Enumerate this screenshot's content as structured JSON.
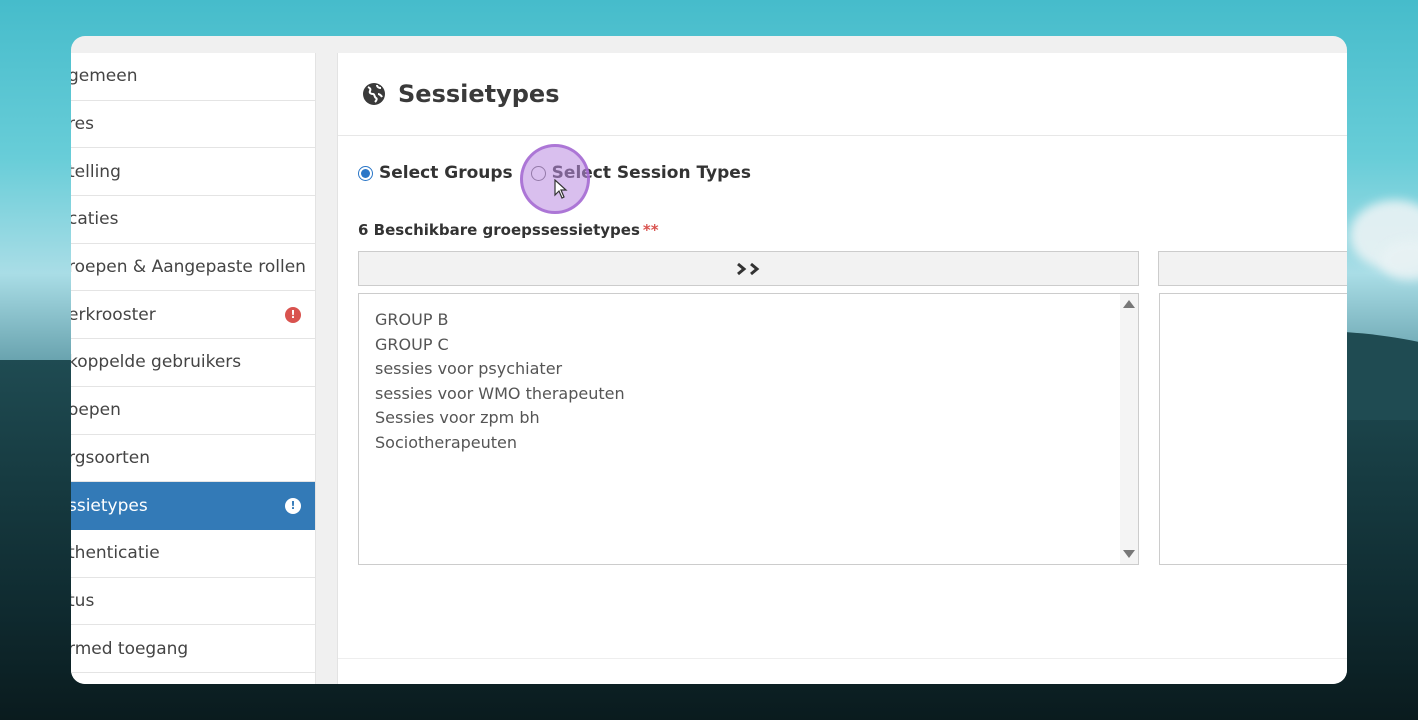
{
  "sidebar": {
    "items": [
      {
        "label": "gemeen",
        "alert": false,
        "active": false
      },
      {
        "label": "res",
        "alert": false,
        "active": false
      },
      {
        "label": "telling",
        "alert": false,
        "active": false
      },
      {
        "label": "caties",
        "alert": false,
        "active": false
      },
      {
        "label": "roepen & Aangepaste rollen",
        "alert": false,
        "active": false
      },
      {
        "label": "erkrooster",
        "alert": true,
        "active": false
      },
      {
        "label": "koppelde gebruikers",
        "alert": false,
        "active": false
      },
      {
        "label": "oepen",
        "alert": false,
        "active": false
      },
      {
        "label": "rgsoorten",
        "alert": false,
        "active": false
      },
      {
        "label": "ssietypes",
        "alert": true,
        "active": true
      },
      {
        "label": "thenticatie",
        "alert": false,
        "active": false
      },
      {
        "label": "tus",
        "alert": false,
        "active": false
      },
      {
        "label": "rmed toegang",
        "alert": false,
        "active": false
      }
    ],
    "alert_glyph": "!"
  },
  "panel": {
    "title": "Sessietypes",
    "title_icon": "globe-icon",
    "radio": {
      "option1": "Select Groups",
      "option2": "Select Session Types",
      "selected": "option1"
    },
    "available_label": "6 Beschikbare groepssessietypes",
    "required_mark": "**",
    "move_button": "»",
    "available_items": [
      "GROUP B",
      "GROUP C",
      "sessies voor psychiater",
      "sessies voor WMO therapeuten",
      "Sessies voor zpm bh",
      "Sociotherapeuten"
    ]
  },
  "colors": {
    "accent": "#337ab7",
    "alert": "#d9534f",
    "radio": "#2a76c7",
    "click_indicator": "#ba8ae0"
  }
}
